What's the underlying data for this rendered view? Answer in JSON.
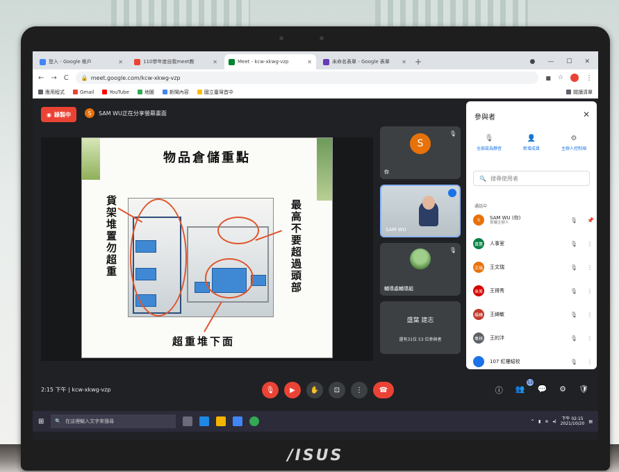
{
  "browser": {
    "tabs": [
      {
        "label": "登入 - Google 帳戶",
        "color": "#4285f4",
        "active": false
      },
      {
        "label": "110學年度自我meet教",
        "color": "#ea4335",
        "active": false
      },
      {
        "label": "Meet - kcw-xkwg-vzp",
        "color": "#00832d",
        "active": true
      },
      {
        "label": "未命名表單 - Google 表單",
        "color": "#673ab7",
        "active": false
      }
    ],
    "new_tab": "+",
    "url": "meet.google.com/kcw-xkwg-vzp",
    "bookmarks": [
      {
        "label": "應用程式",
        "color": "#5f6368"
      },
      {
        "label": "Gmail",
        "color": "#ea4335"
      },
      {
        "label": "YouTube",
        "color": "#ff0000"
      },
      {
        "label": "地圖",
        "color": "#34a853"
      },
      {
        "label": "新聞內容",
        "color": "#4285f4"
      },
      {
        "label": "國立臺灣首中",
        "color": "#fbbc04"
      }
    ],
    "reading_list": "閱讀清單"
  },
  "meet": {
    "recording_label": "錄製中",
    "presenter_initial": "S",
    "presenting_text": "SAM WU正在分享螢幕畫面",
    "slide": {
      "title": "物品倉儲重點",
      "left_text": "貨架堆置勿超重",
      "right_text": "最高不要超過頭部",
      "bottom_text": "超重堆下面"
    },
    "tiles": [
      {
        "name": "你",
        "initial": "S",
        "type": "avatar"
      },
      {
        "name": "SAM WU",
        "type": "video"
      },
      {
        "name": "輔導處輔導組",
        "type": "photo"
      },
      {
        "name": "還有31位 53 位參與者",
        "extra": "盛葉 建志",
        "type": "more"
      }
    ],
    "participants_panel": {
      "title": "參與者",
      "actions": [
        "全部設為靜音",
        "新增成員",
        "主辦人控制項"
      ],
      "search_placeholder": "搜尋使用者",
      "section": "通話中",
      "people": [
        {
          "initial": "S",
          "name": "SAM WU (你)",
          "sub": "會議主辦人",
          "color": "#e8710a"
        },
        {
          "initial": "黃蕙",
          "name": "人事室",
          "sub": "",
          "color": "#0b8043"
        },
        {
          "initial": "文瑞",
          "name": "王文瑞",
          "sub": "",
          "color": "#e8710a"
        },
        {
          "initial": "吳美",
          "name": "王得秀",
          "sub": "",
          "color": "#d50000"
        },
        {
          "initial": "楊樺",
          "name": "王綺敏",
          "sub": "",
          "color": "#c0392b"
        },
        {
          "initial": "韋祥",
          "name": "王的泮",
          "sub": "",
          "color": "#5f6368"
        },
        {
          "initial": "",
          "name": "107 紅樓紹校",
          "sub": "",
          "color": "#1a73e8"
        }
      ]
    },
    "bottom": {
      "time": "2:15 下午",
      "code": "kcw-xkwg-vzp",
      "participant_count": "53"
    }
  },
  "taskbar": {
    "search_placeholder": "在這裡輸入文字來搜尋",
    "time": "下午 02:15",
    "date": "2021/10/20"
  },
  "laptop_brand": "/ISUS"
}
